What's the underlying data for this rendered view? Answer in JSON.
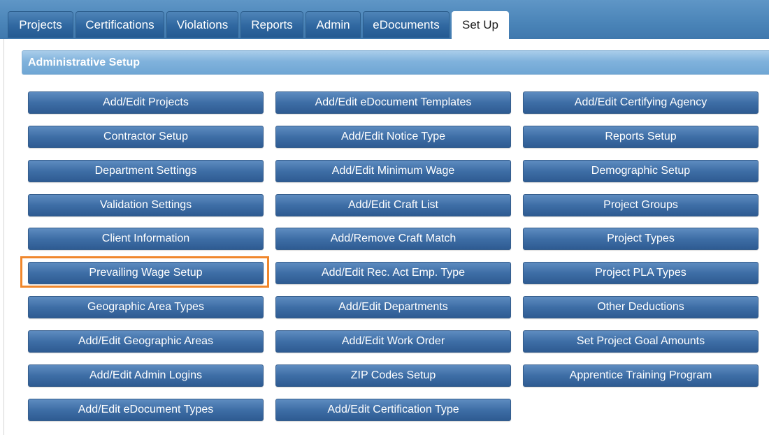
{
  "tabs": [
    {
      "label": "Projects"
    },
    {
      "label": "Certifications"
    },
    {
      "label": "Violations"
    },
    {
      "label": "Reports"
    },
    {
      "label": "Admin"
    },
    {
      "label": "eDocuments"
    },
    {
      "label": "Set Up",
      "active": true
    }
  ],
  "section": {
    "title": "Administrative Setup"
  },
  "columns": [
    [
      "Add/Edit Projects",
      "Contractor Setup",
      "Department Settings",
      "Validation Settings",
      "Client Information",
      "Prevailing Wage Setup",
      "Geographic Area Types",
      "Add/Edit Geographic Areas",
      "Add/Edit Admin Logins",
      "Add/Edit eDocument Types"
    ],
    [
      "Add/Edit eDocument Templates",
      "Add/Edit Notice Type",
      "Add/Edit Minimum Wage",
      "Add/Edit Craft List",
      "Add/Remove Craft Match",
      "Add/Edit Rec. Act Emp. Type",
      "Add/Edit Departments",
      "Add/Edit Work Order",
      "ZIP Codes Setup",
      "Add/Edit Certification Type"
    ],
    [
      "Add/Edit Certifying Agency",
      "Reports Setup",
      "Demographic Setup",
      "Project Groups",
      "Project Types",
      "Project PLA Types",
      "Other Deductions",
      "Set Project Goal Amounts",
      "Apprentice Training Program"
    ]
  ],
  "highlighted": "Prevailing Wage Setup",
  "colors": {
    "highlight": "#f0872c",
    "button": "#3e6ea6",
    "header": "#80b2dc"
  }
}
